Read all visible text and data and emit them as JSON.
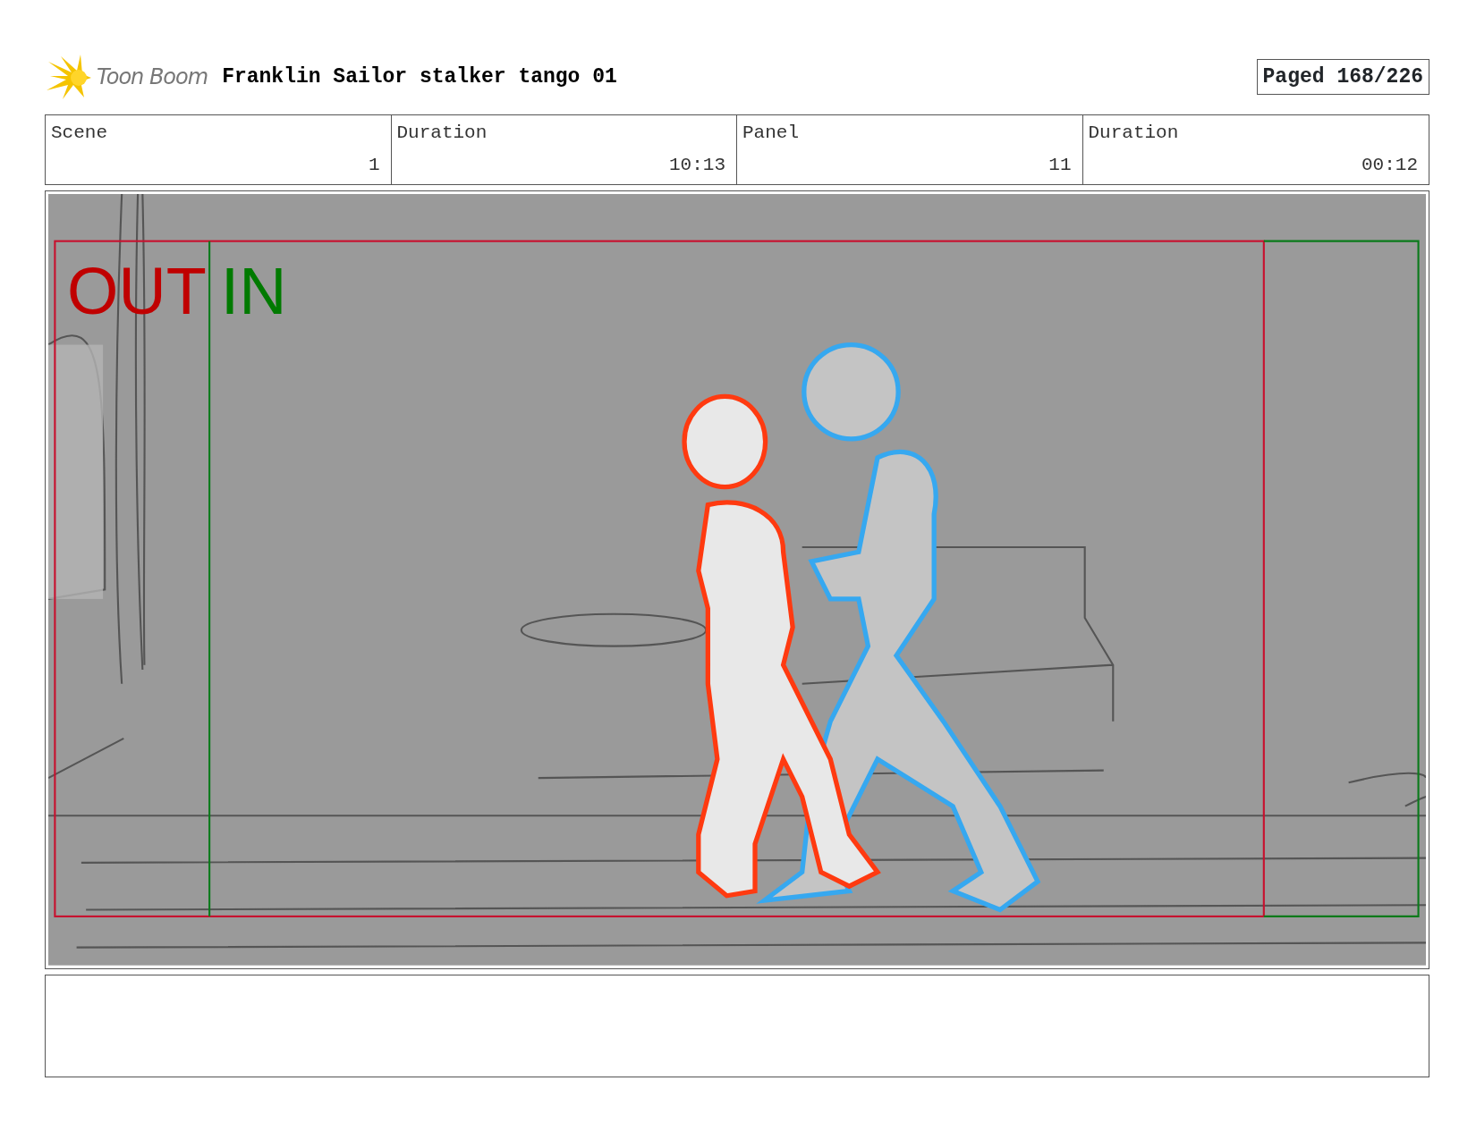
{
  "header": {
    "logo_text": "Toon Boom",
    "title": "Franklin Sailor stalker tango 01",
    "page_label": "Paged 168/226"
  },
  "info": [
    {
      "label": "Scene",
      "value": "1"
    },
    {
      "label": "Duration",
      "value": "10:13"
    },
    {
      "label": "Panel",
      "value": "11"
    },
    {
      "label": "Duration",
      "value": "00:12"
    }
  ],
  "panel": {
    "out_label": "OUT",
    "in_label": "IN"
  }
}
